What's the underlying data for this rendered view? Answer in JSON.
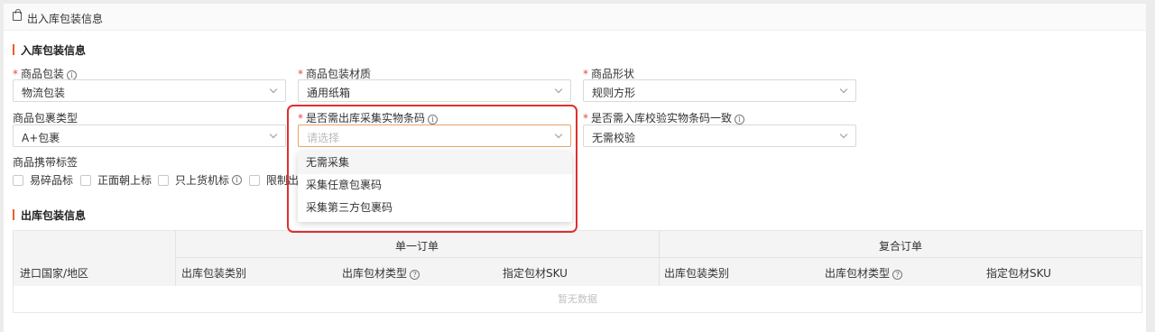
{
  "panel": {
    "title": "出入库包装信息"
  },
  "inbound": {
    "title": "入库包装信息",
    "fields": {
      "packaging": {
        "label": "商品包装",
        "value": "物流包装"
      },
      "material": {
        "label": "商品包装材质",
        "value": "通用纸箱"
      },
      "shape": {
        "label": "商品形状",
        "value": "规则方形"
      },
      "parcel_type": {
        "label": "商品包裹类型",
        "value": "A+包裹"
      },
      "outbound_barcode": {
        "label": "是否需出库采集实物条码",
        "placeholder": "请选择"
      },
      "inbound_check": {
        "label": "是否需入库校验实物条码一致",
        "value": "无需校验"
      }
    },
    "tags": {
      "label": "商品携带标签",
      "items": [
        "易碎品标",
        "正面朝上标",
        "只上货机标",
        "限制出"
      ]
    }
  },
  "dropdown": {
    "options": [
      "无需采集",
      "采集任意包裹码",
      "采集第三方包裹码"
    ]
  },
  "outbound": {
    "title": "出库包装信息",
    "table": {
      "group_single": "单一订单",
      "group_combined": "复合订单",
      "col_country": "进口国家/地区",
      "single_cols": [
        "出库包装类别",
        "出库包材类型",
        "指定包材SKU"
      ],
      "combined_cols": [
        "出库包装类别",
        "出库包材类型",
        "指定包材SKU"
      ],
      "empty_text": "暂无数据"
    }
  }
}
